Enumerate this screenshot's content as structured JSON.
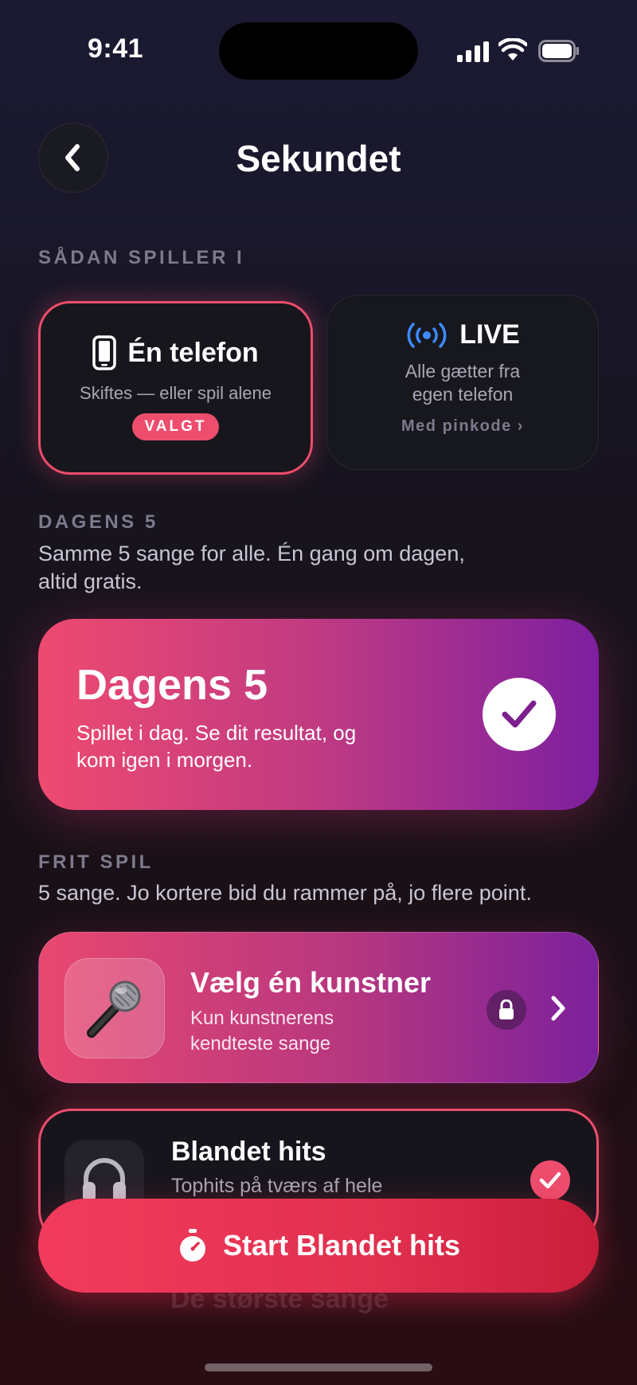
{
  "status_bar": {
    "time": "9:41"
  },
  "header": {
    "title": "Sekundet"
  },
  "play_mode": {
    "label": "SÅDAN SPILLER I",
    "one_phone": {
      "title": "Én telefon",
      "subtitle": "Skiftes — eller spil alene",
      "badge": "VALGT",
      "icon": "phone-icon"
    },
    "live": {
      "title": "LIVE",
      "subtitle_line1": "Alle gætter fra",
      "subtitle_line2": "egen telefon",
      "link": "Med pinkode ›",
      "icon": "broadcast-icon"
    }
  },
  "daily": {
    "label": "DAGENS 5",
    "desc_line1": "Samme 5 sange for alle. Én gang om dagen,",
    "desc_line2": "altid gratis.",
    "card_title": "Dagens 5",
    "card_text_line1": "Spillet i dag. Se dit resultat, og",
    "card_text_line2": "kom igen i morgen."
  },
  "free_play": {
    "label": "FRIT SPIL",
    "desc": "5 sange. Jo kortere bid du rammer på, jo flere point.",
    "artist": {
      "title": "Vælg én kunstner",
      "subtitle_line1": "Kun kunstnerens",
      "subtitle_line2": "kendteste sange",
      "icon": "microphone-icon"
    },
    "mix": {
      "title": "Blandet hits",
      "subtitle": "Tophits på tværs af hele",
      "icon": "headphones-icon"
    },
    "next_item_title": "De største sange"
  },
  "start_button": {
    "label": "Start Blandet hits",
    "icon": "stopwatch-icon"
  },
  "colors": {
    "accent": "#ee4d6d",
    "gradient_start": "#ee4a70",
    "gradient_end": "#7d1fa0",
    "live_blue": "#3d8bff"
  }
}
